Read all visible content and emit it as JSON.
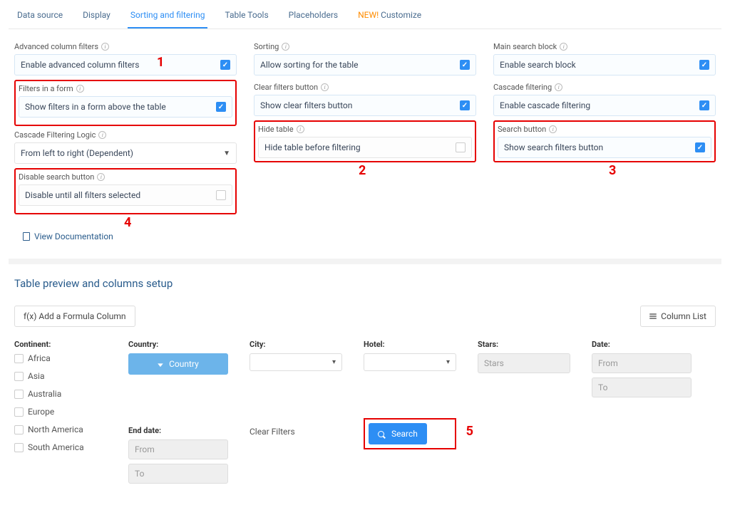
{
  "tabs": {
    "data_source": "Data source",
    "display": "Display",
    "sorting_filtering": "Sorting and filtering",
    "table_tools": "Table Tools",
    "placeholders": "Placeholders",
    "customize_new": "NEW!",
    "customize": " Customize"
  },
  "col1": {
    "adv_filter_label": "Advanced column filters",
    "adv_filter_box": "Enable advanced column filters",
    "form_label": "Filters in a form",
    "form_box": "Show filters in a form above the table",
    "cascade_logic_label": "Cascade Filtering Logic",
    "cascade_logic_box": "From left to right (Dependent)",
    "disable_search_label": "Disable search button",
    "disable_search_box": "Disable until all filters selected"
  },
  "col2": {
    "sorting_label": "Sorting",
    "sorting_box": "Allow sorting for the table",
    "clear_label": "Clear filters button",
    "clear_box": "Show clear filters button",
    "hide_label": "Hide table",
    "hide_box": "Hide table before filtering"
  },
  "col3": {
    "main_search_label": "Main search block",
    "main_search_box": "Enable search block",
    "cascade_label": "Cascade filtering",
    "cascade_box": "Enable cascade filtering",
    "search_btn_label": "Search button",
    "search_btn_box": "Show search filters button"
  },
  "annot": {
    "n1": "1",
    "n2": "2",
    "n3": "3",
    "n4": "4",
    "n5": "5"
  },
  "doc": {
    "label": "View Documentation"
  },
  "preview": {
    "title": "Table preview and columns setup",
    "add_formula": "f(x)  Add a Formula Column",
    "column_list": "Column List",
    "continent_label": "Continent:",
    "continents": [
      "Africa",
      "Asia",
      "Australia",
      "Europe",
      "North America",
      "South America"
    ],
    "country_label": "Country:",
    "country_btn": "Country",
    "city_label": "City:",
    "hotel_label": "Hotel:",
    "stars_label": "Stars:",
    "stars_ph": "Stars",
    "date_label": "Date:",
    "from_ph": "From",
    "to_ph": "To",
    "enddate_label": "End date:",
    "clear_filters": "Clear Filters",
    "search": "Search"
  }
}
